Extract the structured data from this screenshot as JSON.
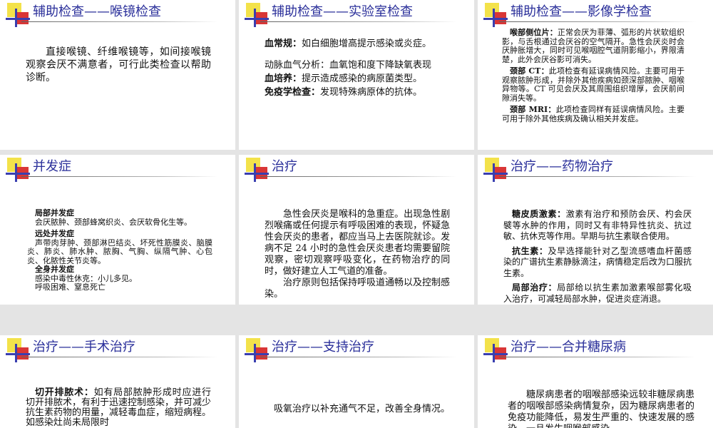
{
  "slides": [
    {
      "title": "辅助检查——喉镜检查",
      "p1": "直接喉镜、纤维喉镜等，如间接喉镜观察会厌不满意者，可行此类检查以帮助诊断。"
    },
    {
      "title": "辅助检查——实验室检查",
      "p1_label": "血常规：",
      "p1_text": "如白细胞增高提示感染或炎症。",
      "p2": "动脉血气分析：血氧饱和度下降缺氧表现",
      "p3_label": "血培养：",
      "p3_text": "提示造成感染的病原菌类型。",
      "p4_label": "免疫学检查：",
      "p4_text": "发现特殊病原体的抗体。"
    },
    {
      "title": "辅助检查——影像学检查",
      "p1_label": "喉部侧位片：",
      "p1_text": "正常会厌为菲薄、弧形的片状软组织影，与舌根通过会厌谷的空气隔开。急性会厌炎时会厌肿胀增大，同时可见喉咽腔气道阴影缩小，界限清楚，此外会厌谷影可消失。",
      "p2_label": "颈部 CT：",
      "p2_text": "此项检查有延误病情风险。主要可用于观察脓肿形成，并除外其他疾病如颈深部脓肿、咽喉异物等。CT 可见会厌及其周围组织增厚，会厌前间隙消失等。",
      "p3_label": "颈部 MRI：",
      "p3_text": "此项检查同样有延误病情风险。主要可用于除外其他疾病及确认相关并发症。"
    },
    {
      "title": "并发症",
      "h1": "局部并发症",
      "t1": "会厌脓肿、颈部蜂窝织炎、会厌软骨化生等。",
      "h2": "远处并发症",
      "t2": "声带肉芽肿、颈部淋巴结炎、坏死性筋膜炎、脑膜炎、肺炎、肺水肿、脓胸、气胸、纵隔气肿、心包炎、化脓性关节炎等。",
      "h3": "全身并发症",
      "t3a": "感染中毒性休克：小儿多见。",
      "t3b": "呼吸困难、窒息死亡"
    },
    {
      "title": "治疗",
      "p1": "急性会厌炎是喉科的急重症。出现急性剧烈喉痛或任何提示有呼吸困难的表现，怀疑急性会厌炎的患者，都应当马上去医院就诊。发病不足 24 小时的急性会厌炎患者均需要留院观察，密切观察呼吸变化，在药物治疗的同时，做好建立人工气道的准备。",
      "p2": "治疗原则包括保持呼吸道通畅以及控制感染。"
    },
    {
      "title": "治疗——药物治疗",
      "p1_label": "糖皮质激素：",
      "p1_text": "激素有治疗和预防会厌、杓会厌襞等水肿的作用，同时又有非特异性抗炎、抗过敏、抗休克等作用。早期与抗生素联合使用。",
      "p2_label": "抗生素：",
      "p2_text": "及早选择能针对乙型流感嗜血杆菌感染的广谱抗生素静脉滴注，病情稳定后改为口服抗生素。",
      "p3_label": "局部治疗：",
      "p3_text": "局部给以抗生素加激素喉部雾化吸入治疗，可减轻局部水肿，促进炎症消退。"
    },
    {
      "title": "治疗——手术治疗",
      "p1_label": "切开排脓术：",
      "p1_text": "如有局部脓肿形成时应进行切开排脓术，有利于迅速控制感染，并可减少抗生素药物的用量，减轻毒血症，缩短病程。如感染灶尚未局限时"
    },
    {
      "title": "治疗——支持治疗",
      "p1": "吸氧治疗以补充通气不足，改善全身情况。"
    },
    {
      "title": "治疗——合并糖尿病",
      "p1": "糖尿病患者的咽喉部感染远较非糖尿病患者的咽喉部感染病情复杂，因为糖尿病患者的免疫功能降低，易发生严重的、快速发展的感染，一旦发生咽喉部感染"
    }
  ]
}
